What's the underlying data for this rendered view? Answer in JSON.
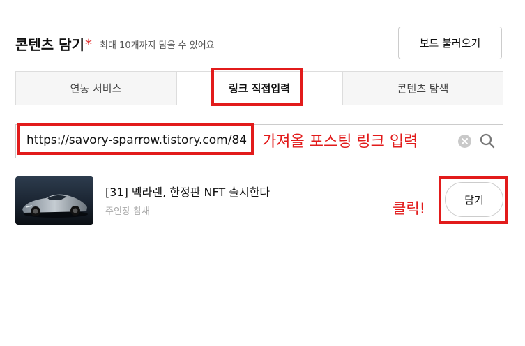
{
  "header": {
    "title": "콘텐츠 담기",
    "required_mark": "*",
    "subtitle": "최대 10개까지 담을 수 있어요",
    "load_board_label": "보드 불러오기"
  },
  "tabs": [
    {
      "label": "연동 서비스",
      "active": false
    },
    {
      "label": "링크 직접입력",
      "active": true
    },
    {
      "label": "콘텐츠 탐색",
      "active": false
    }
  ],
  "search": {
    "value": "https://savory-sparrow.tistory.com/84",
    "annotation": "가져올 포스팅 링크 입력"
  },
  "result": {
    "title": "[31] 멕라렌, 한정판 NFT 출시한다",
    "author": "주인장 참새",
    "add_label": "담기",
    "annotation": "클릭!"
  },
  "colors": {
    "highlight": "#e21b1b",
    "accent": "#e03131"
  }
}
